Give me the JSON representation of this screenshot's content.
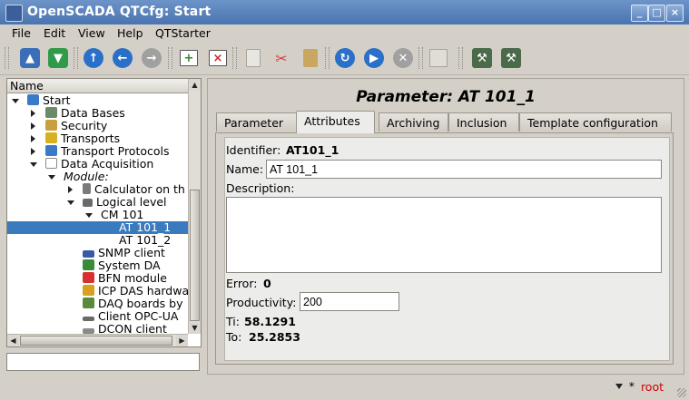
{
  "window": {
    "title": "OpenSCADA QTCfg: Start"
  },
  "menu": [
    {
      "label": "File"
    },
    {
      "label": "Edit"
    },
    {
      "label": "View"
    },
    {
      "label": "Help"
    },
    {
      "label": "QTStarter"
    }
  ],
  "toolbar": [
    {
      "icon": "db-load-icon",
      "color": "#3a6fb8"
    },
    {
      "icon": "db-save-icon",
      "color": "#2f9a4a"
    },
    {
      "icon": "up-icon",
      "color": "#2a6fc8"
    },
    {
      "icon": "back-icon",
      "color": "#2a6fc8"
    },
    {
      "icon": "forward-icon",
      "color": "#a0a0a0"
    },
    {
      "icon": "item-add-icon",
      "color": "#3a7a3a"
    },
    {
      "icon": "item-delete-icon",
      "color": "#c03030"
    },
    {
      "icon": "copy-icon",
      "color": "#b8b4ac"
    },
    {
      "icon": "cut-icon",
      "color": "#d04040"
    },
    {
      "icon": "paste-icon",
      "color": "#c8a860"
    },
    {
      "icon": "refresh-icon",
      "color": "#2a6fc8"
    },
    {
      "icon": "start-icon",
      "color": "#2a6fc8"
    },
    {
      "icon": "stop-icon",
      "color": "#a0a0a0"
    },
    {
      "icon": "manual-icon",
      "color": "#c0bcb4"
    },
    {
      "icon": "station-icon",
      "color": "#4a6a4a"
    },
    {
      "icon": "station-remote-icon",
      "color": "#4a6a4a"
    }
  ],
  "tree": {
    "header": "Name",
    "items": [
      {
        "label": "Start",
        "icon": "station-icon",
        "icon_color": "#3a7ac8"
      },
      {
        "label": "Data Bases",
        "icon": "database-icon",
        "icon_color": "#6a8a6a"
      },
      {
        "label": "Security",
        "icon": "security-icon",
        "icon_color": "#c8a040"
      },
      {
        "label": "Transports",
        "icon": "transport-icon",
        "icon_color": "#d8b020"
      },
      {
        "label": "Transport Protocols",
        "icon": "protocol-icon",
        "icon_color": "#3a7ac8"
      },
      {
        "label": "Data Acquisition",
        "icon": "daq-icon",
        "icon_color": "#8a8a8a"
      },
      {
        "label": "Module:",
        "icon": "",
        "icon_color": ""
      },
      {
        "label": "Calculator on th",
        "icon": "calculator-icon",
        "icon_color": "#7a7a7a"
      },
      {
        "label": "Logical level",
        "icon": "logic-icon",
        "icon_color": "#6a6a6a"
      },
      {
        "label": "CM 101",
        "icon": "",
        "icon_color": ""
      },
      {
        "label": "AT 101_1",
        "icon": "",
        "icon_color": ""
      },
      {
        "label": "AT 101_2",
        "icon": "",
        "icon_color": ""
      },
      {
        "label": "SNMP client",
        "icon": "snmp-icon",
        "icon_color": "#3a5aa8"
      },
      {
        "label": "System DA",
        "icon": "system-da-icon",
        "icon_color": "#3a8a3a"
      },
      {
        "label": "BFN module",
        "icon": "bfn-icon",
        "icon_color": "#d83030"
      },
      {
        "label": "ICP DAS hardwa",
        "icon": "icp-das-icon",
        "icon_color": "#d8a020"
      },
      {
        "label": "DAQ boards by",
        "icon": "daq-board-icon",
        "icon_color": "#5a8a3a"
      },
      {
        "label": "Client OPC-UA",
        "icon": "opc-ua-icon",
        "icon_color": "#6a6a6a"
      },
      {
        "label": "DCON client",
        "icon": "dcon-icon",
        "icon_color": "#8a8a8a"
      }
    ]
  },
  "parameter": {
    "title": "Parameter: AT 101_1",
    "tabs": [
      {
        "label": "Parameter"
      },
      {
        "label": "Attributes"
      },
      {
        "label": "Archiving"
      },
      {
        "label": "Inclusion"
      },
      {
        "label": "Template configuration"
      }
    ],
    "identifier_label": "Identifier:",
    "identifier_value": "AT101_1",
    "name_label": "Name:",
    "name_value": "AT 101_1",
    "description_label": "Description:",
    "description_value": "",
    "error_label": "Error:",
    "error_value": "0",
    "productivity_label": "Productivity:",
    "productivity_value": "200",
    "ti_label": "Ti:",
    "ti_value": "58.1291",
    "to_label": "To:",
    "to_value": "25.2853"
  },
  "status": {
    "modified_mark": "*",
    "user": "root"
  }
}
